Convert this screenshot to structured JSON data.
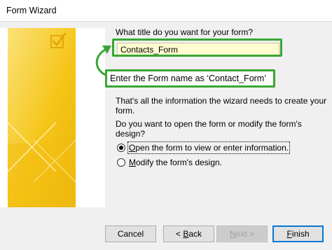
{
  "window": {
    "title": "Form Wizard"
  },
  "form": {
    "question": "What title do you want for your form?",
    "title_value": "Contacts_Form",
    "annotation": "Enter the Form name as ‘Contact_Form’",
    "info": "That's all the information the wizard needs to create your form.",
    "open_question": "Do you want to open the form or modify the form's design?",
    "options": [
      {
        "mnemonic": "O",
        "rest": "pen the form to view or enter information.",
        "selected": true
      },
      {
        "mnemonic": "M",
        "rest": "odify the form's design.",
        "selected": false
      }
    ]
  },
  "buttons": {
    "cancel": "Cancel",
    "back_prefix": "< ",
    "back_mnemonic": "B",
    "back_rest": "ack",
    "next_mnemonic": "N",
    "next_rest": "ext >",
    "finish_mnemonic": "F",
    "finish_rest": "inish"
  },
  "colors": {
    "annotation_green": "#3aa635",
    "input_background": "#fffdd0",
    "graphic_yellow": "#f5c518",
    "finish_focus": "#0078d7"
  },
  "icons": {
    "side_graphic": "form-checkmark-icon"
  }
}
